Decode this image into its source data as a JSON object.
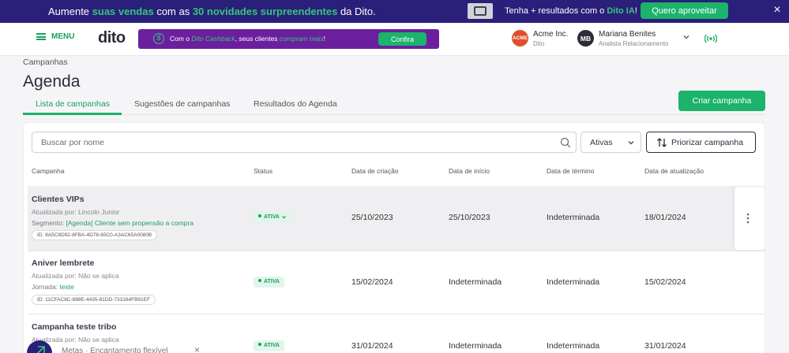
{
  "promo": {
    "text_pre": "Aumente ",
    "text_hl1": "suas vendas",
    "text_mid": " com as ",
    "text_hl2": "30 novidades surpreendentes",
    "text_post": " da Dito.",
    "right_pre": "Tenha + resultados com o ",
    "right_hl": "Dito IA",
    "right_post": "!",
    "button": "Quero aproveitar",
    "close": "×"
  },
  "header": {
    "menu_label": "MENU",
    "logo": "dito",
    "cashback_pre": "Com o ",
    "cashback_hl1": "Dito Cashback",
    "cashback_mid": ", seus clientes ",
    "cashback_hl2": "compram mais",
    "cashback_post": "!",
    "cashback_button": "Confira",
    "company_initials": "ACME",
    "company_name": "Acme Inc.",
    "company_sub": "Dito",
    "user_initials": "MB",
    "user_name": "Mariana Benites",
    "user_role": "Analista Relacionamento"
  },
  "page": {
    "breadcrumb": "Campanhas",
    "title": "Agenda",
    "tabs": [
      {
        "label": "Lista de campanhas"
      },
      {
        "label": "Sugestões de campanhas"
      },
      {
        "label": "Resultados do Agenda"
      }
    ],
    "create_button": "Criar campanha"
  },
  "filters": {
    "search_placeholder": "Buscar por nome",
    "status_value": "Ativas",
    "prioritize_button": "Priorizar campanha"
  },
  "table": {
    "headers": [
      "Campanha",
      "Status",
      "Data de criação",
      "Data de início",
      "Data de término",
      "Data de atualização"
    ],
    "rows": [
      {
        "name": "Clientes VIPs",
        "updated_by": "Atualizada por: Lincoln Junior",
        "seg_label": "Segmento: ",
        "seg_value": "[Agenda] Cliente sem propensão a compra",
        "id": "ID: 8A5C8D92-8FBA-4D78-65C0-A3AC65A0080B",
        "status": "ATIVA",
        "created": "25/10/2023",
        "start": "25/10/2023",
        "end": "Indeterminada",
        "updated": "18/01/2024"
      },
      {
        "name": "Aniver lembrete",
        "updated_by": "Atualizada por: Não se aplica",
        "seg_label": "Jornada: ",
        "seg_value": "teste",
        "id": "ID: 11CFAC8C-888E-4435-81DD-733164FB91EF",
        "status": "ATIVA",
        "created": "15/02/2024",
        "start": "Indeterminada",
        "end": "Indeterminada",
        "updated": "15/02/2024"
      },
      {
        "name": "Campanha teste tribo",
        "updated_by": "Atualizada por: Não se aplica",
        "status": "ATIVA",
        "created": "31/01/2024",
        "start": "Indeterminada",
        "end": "Indeterminada",
        "updated": "31/01/2024"
      }
    ]
  },
  "bottom_bar": {
    "text": "Metas  ·  Encantamento flexível",
    "close": "×"
  },
  "colors": {
    "brand_green": "#1cb36b",
    "promo_bg": "#2a1f7a",
    "cashback_bg": "#6b1f9e"
  }
}
